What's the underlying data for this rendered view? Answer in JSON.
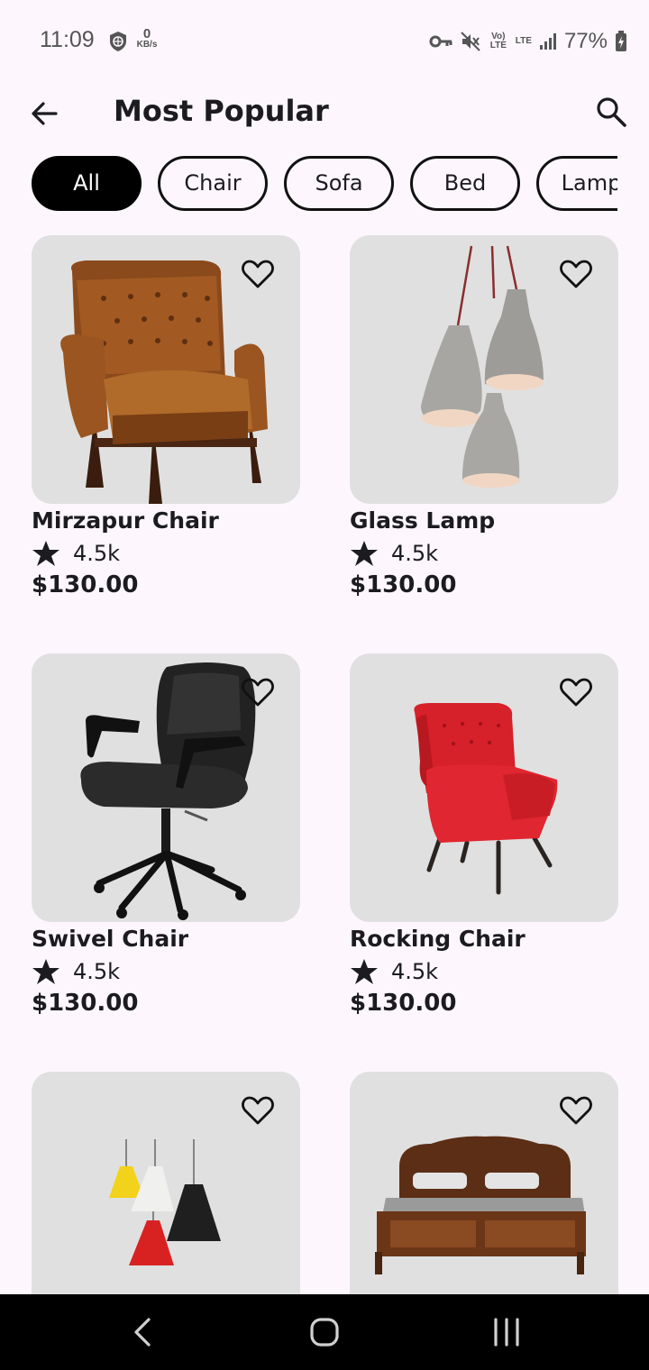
{
  "status_bar": {
    "time": "11:09",
    "net_speed_value": "0",
    "net_speed_unit": "KB/s",
    "volte_label": "Vo) LTE",
    "lte_label": "LTE",
    "battery_percent": "77%"
  },
  "app_bar": {
    "title": "Most Popular"
  },
  "filters": {
    "active": "All",
    "chips": [
      "All",
      "Chair",
      "Sofa",
      "Bed",
      "Lamp"
    ]
  },
  "products": [
    {
      "name": "Mirzapur Chair",
      "rating": "4.5k",
      "price": "$130.00",
      "image": "leather-wingback-chair"
    },
    {
      "name": "Glass Lamp",
      "rating": "4.5k",
      "price": "$130.00",
      "image": "pendant-lamps"
    },
    {
      "name": "Swivel Chair",
      "rating": "4.5k",
      "price": "$130.00",
      "image": "office-chair"
    },
    {
      "name": "Rocking Chair",
      "rating": "4.5k",
      "price": "$130.00",
      "image": "red-armchair"
    },
    {
      "name": "",
      "rating": "",
      "price": "",
      "image": "colorful-pendant-lamps"
    },
    {
      "name": "",
      "rating": "",
      "price": "",
      "image": "wooden-bed"
    }
  ],
  "colors": {
    "background": "#fdf7fd",
    "card": "#e0e0e0",
    "chip_active": "#000000",
    "text": "#1c1b1f"
  }
}
